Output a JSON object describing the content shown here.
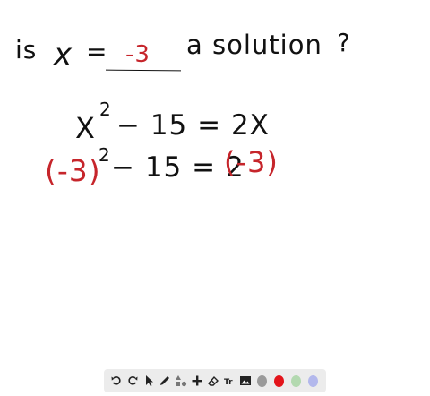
{
  "question": {
    "prefix": "is",
    "variable": "x",
    "equals": "=",
    "value": "-3",
    "suffix": "a solution",
    "qmark": "?"
  },
  "equation": {
    "x": "X",
    "exp": "2",
    "rest": "− 15 = 2X"
  },
  "substituted": {
    "base": "(-3)",
    "exp": "2",
    "mid": "− 15 = 2",
    "rhs": "(-3)"
  },
  "toolbar": {
    "tools": [
      "undo-icon",
      "redo-icon",
      "select-icon",
      "pen-icon",
      "shapes-icon",
      "add-icon",
      "eraser-icon",
      "text-icon",
      "image-icon"
    ],
    "colors": [
      "#9a9a9a",
      "#e3141b",
      "#b3d9b0",
      "#b3b8ec"
    ]
  }
}
